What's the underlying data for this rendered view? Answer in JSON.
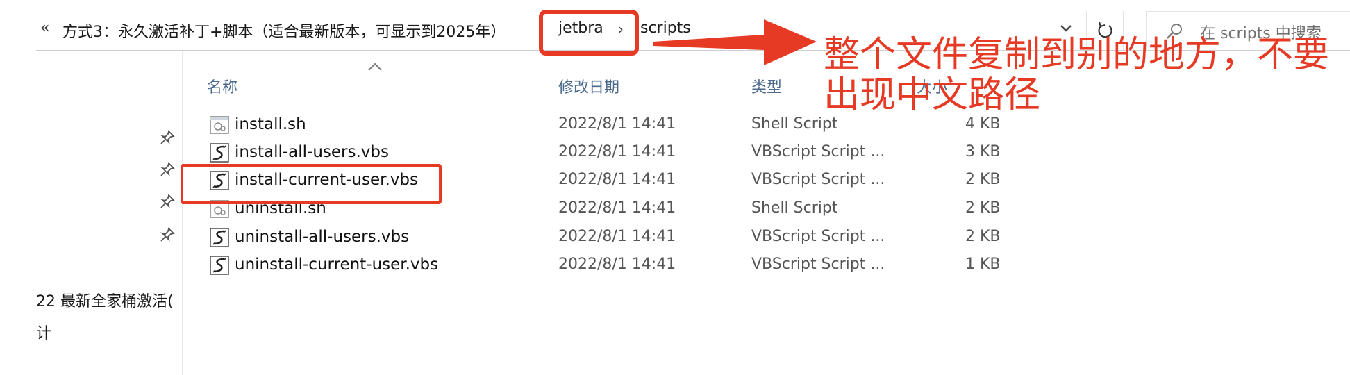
{
  "address_bar": {
    "lead_glyph": "«",
    "parent_crumb": "方式3：永久激活补丁+脚本（适合最新版本，可显示到2025年）",
    "crumb_jetbra": "jetbra",
    "crumb_sep": "›",
    "crumb_scripts": "scripts",
    "dropdown_icon": "chevron-down-icon",
    "refresh_icon": "refresh-icon",
    "search_icon": "search-icon",
    "search_placeholder": "在 scripts 中搜索"
  },
  "nav_pane": {
    "pin_icon": "pin-icon",
    "pinned_count": 4,
    "items": [
      "22 最新全家桶激活(",
      "计"
    ]
  },
  "columns": {
    "name": "名称",
    "date": "修改日期",
    "type": "类型",
    "size": "大小",
    "sorted_by": "name"
  },
  "files": [
    {
      "name": "install.sh",
      "date": "2022/8/1 14:41",
      "type": "Shell Script",
      "size": "4 KB",
      "icon": "shell-script-icon"
    },
    {
      "name": "install-all-users.vbs",
      "date": "2022/8/1 14:41",
      "type": "VBScript Script ...",
      "size": "3 KB",
      "icon": "vbscript-icon"
    },
    {
      "name": "install-current-user.vbs",
      "date": "2022/8/1 14:41",
      "type": "VBScript Script ...",
      "size": "2 KB",
      "icon": "vbscript-icon"
    },
    {
      "name": "uninstall.sh",
      "date": "2022/8/1 14:41",
      "type": "Shell Script",
      "size": "2 KB",
      "icon": "shell-script-icon"
    },
    {
      "name": "uninstall-all-users.vbs",
      "date": "2022/8/1 14:41",
      "type": "VBScript Script ...",
      "size": "2 KB",
      "icon": "vbscript-icon"
    },
    {
      "name": "uninstall-current-user.vbs",
      "date": "2022/8/1 14:41",
      "type": "VBScript Script ...",
      "size": "1 KB",
      "icon": "vbscript-icon"
    }
  ],
  "annotation": {
    "note_line1": "整个文件复制到别的地方，不要",
    "note_line2": "出现中文路径",
    "highlighted_crumb": "jetbra",
    "highlighted_file": "install-current-user.vbs",
    "color": "#e73a25"
  },
  "colors": {
    "header_text": "#4c6a8e",
    "annotation_red": "#e73a25"
  }
}
